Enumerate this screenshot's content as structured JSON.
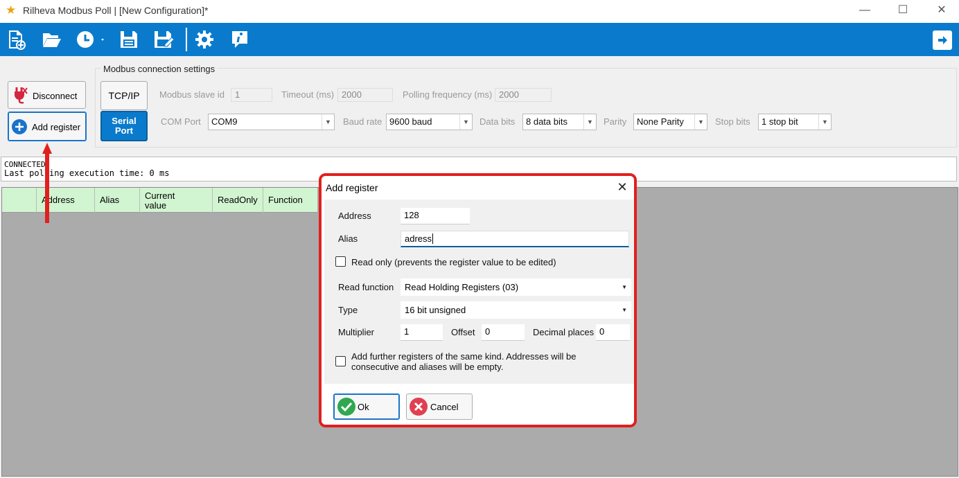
{
  "window": {
    "title": "Rilheva Modbus Poll | [New Configuration]*",
    "minimize": "—",
    "maximize": "☐",
    "close": "✕"
  },
  "toolbar": {
    "icons": [
      "new-file-icon",
      "open-folder-icon",
      "clock-icon",
      "save-icon",
      "save-as-icon",
      "settings-gear-icon",
      "info-icon",
      "exit-icon"
    ]
  },
  "sidebar": {
    "disconnect_label": "Disconnect",
    "add_register_label": "Add register"
  },
  "connection": {
    "legend": "Modbus connection settings",
    "tcp_label": "TCP/IP",
    "serial_label_line1": "Serial",
    "serial_label_line2": "Port",
    "slave_id_label": "Modbus slave id",
    "slave_id_value": "1",
    "timeout_label": "Timeout (ms)",
    "timeout_value": "2000",
    "polling_label": "Polling frequency (ms)",
    "polling_value": "2000",
    "com_port_label": "COM Port",
    "com_port_value": "COM9",
    "baud_label": "Baud rate",
    "baud_value": "9600 baud",
    "data_bits_label": "Data bits",
    "data_bits_value": "8 data bits",
    "parity_label": "Parity",
    "parity_value": "None Parity",
    "stop_bits_label": "Stop bits",
    "stop_bits_value": "1 stop bit"
  },
  "status": {
    "line1": "CONNECTED",
    "line2": "Last polling execution time: 0 ms"
  },
  "grid": {
    "columns": [
      "",
      "Address",
      "Alias",
      "Current value",
      "ReadOnly",
      "Function"
    ]
  },
  "dialog": {
    "title": "Add register",
    "close": "✕",
    "address_label": "Address",
    "address_value": "128",
    "alias_label": "Alias",
    "alias_value": "adress",
    "readonly_label": "Read only (prevents the register value to be edited)",
    "readonly_checked": false,
    "read_function_label": "Read function",
    "read_function_value": "Read Holding Registers (03)",
    "type_label": "Type",
    "type_value": "16 bit unsigned",
    "multiplier_label": "Multiplier",
    "multiplier_value": "1",
    "offset_label": "Offset",
    "offset_value": "0",
    "decimal_label": "Decimal places",
    "decimal_value": "0",
    "further_line1": "Add further registers of the same kind. Addresses will be",
    "further_line2": "consecutive and aliases will be empty.",
    "further_checked": false,
    "ok_label": "Ok",
    "cancel_label": "Cancel"
  },
  "colors": {
    "toolbar_blue": "#0a7bcc",
    "highlight_red": "#e0201e",
    "grid_header_green": "#d1f5d1",
    "grid_bg": "#ababab"
  }
}
